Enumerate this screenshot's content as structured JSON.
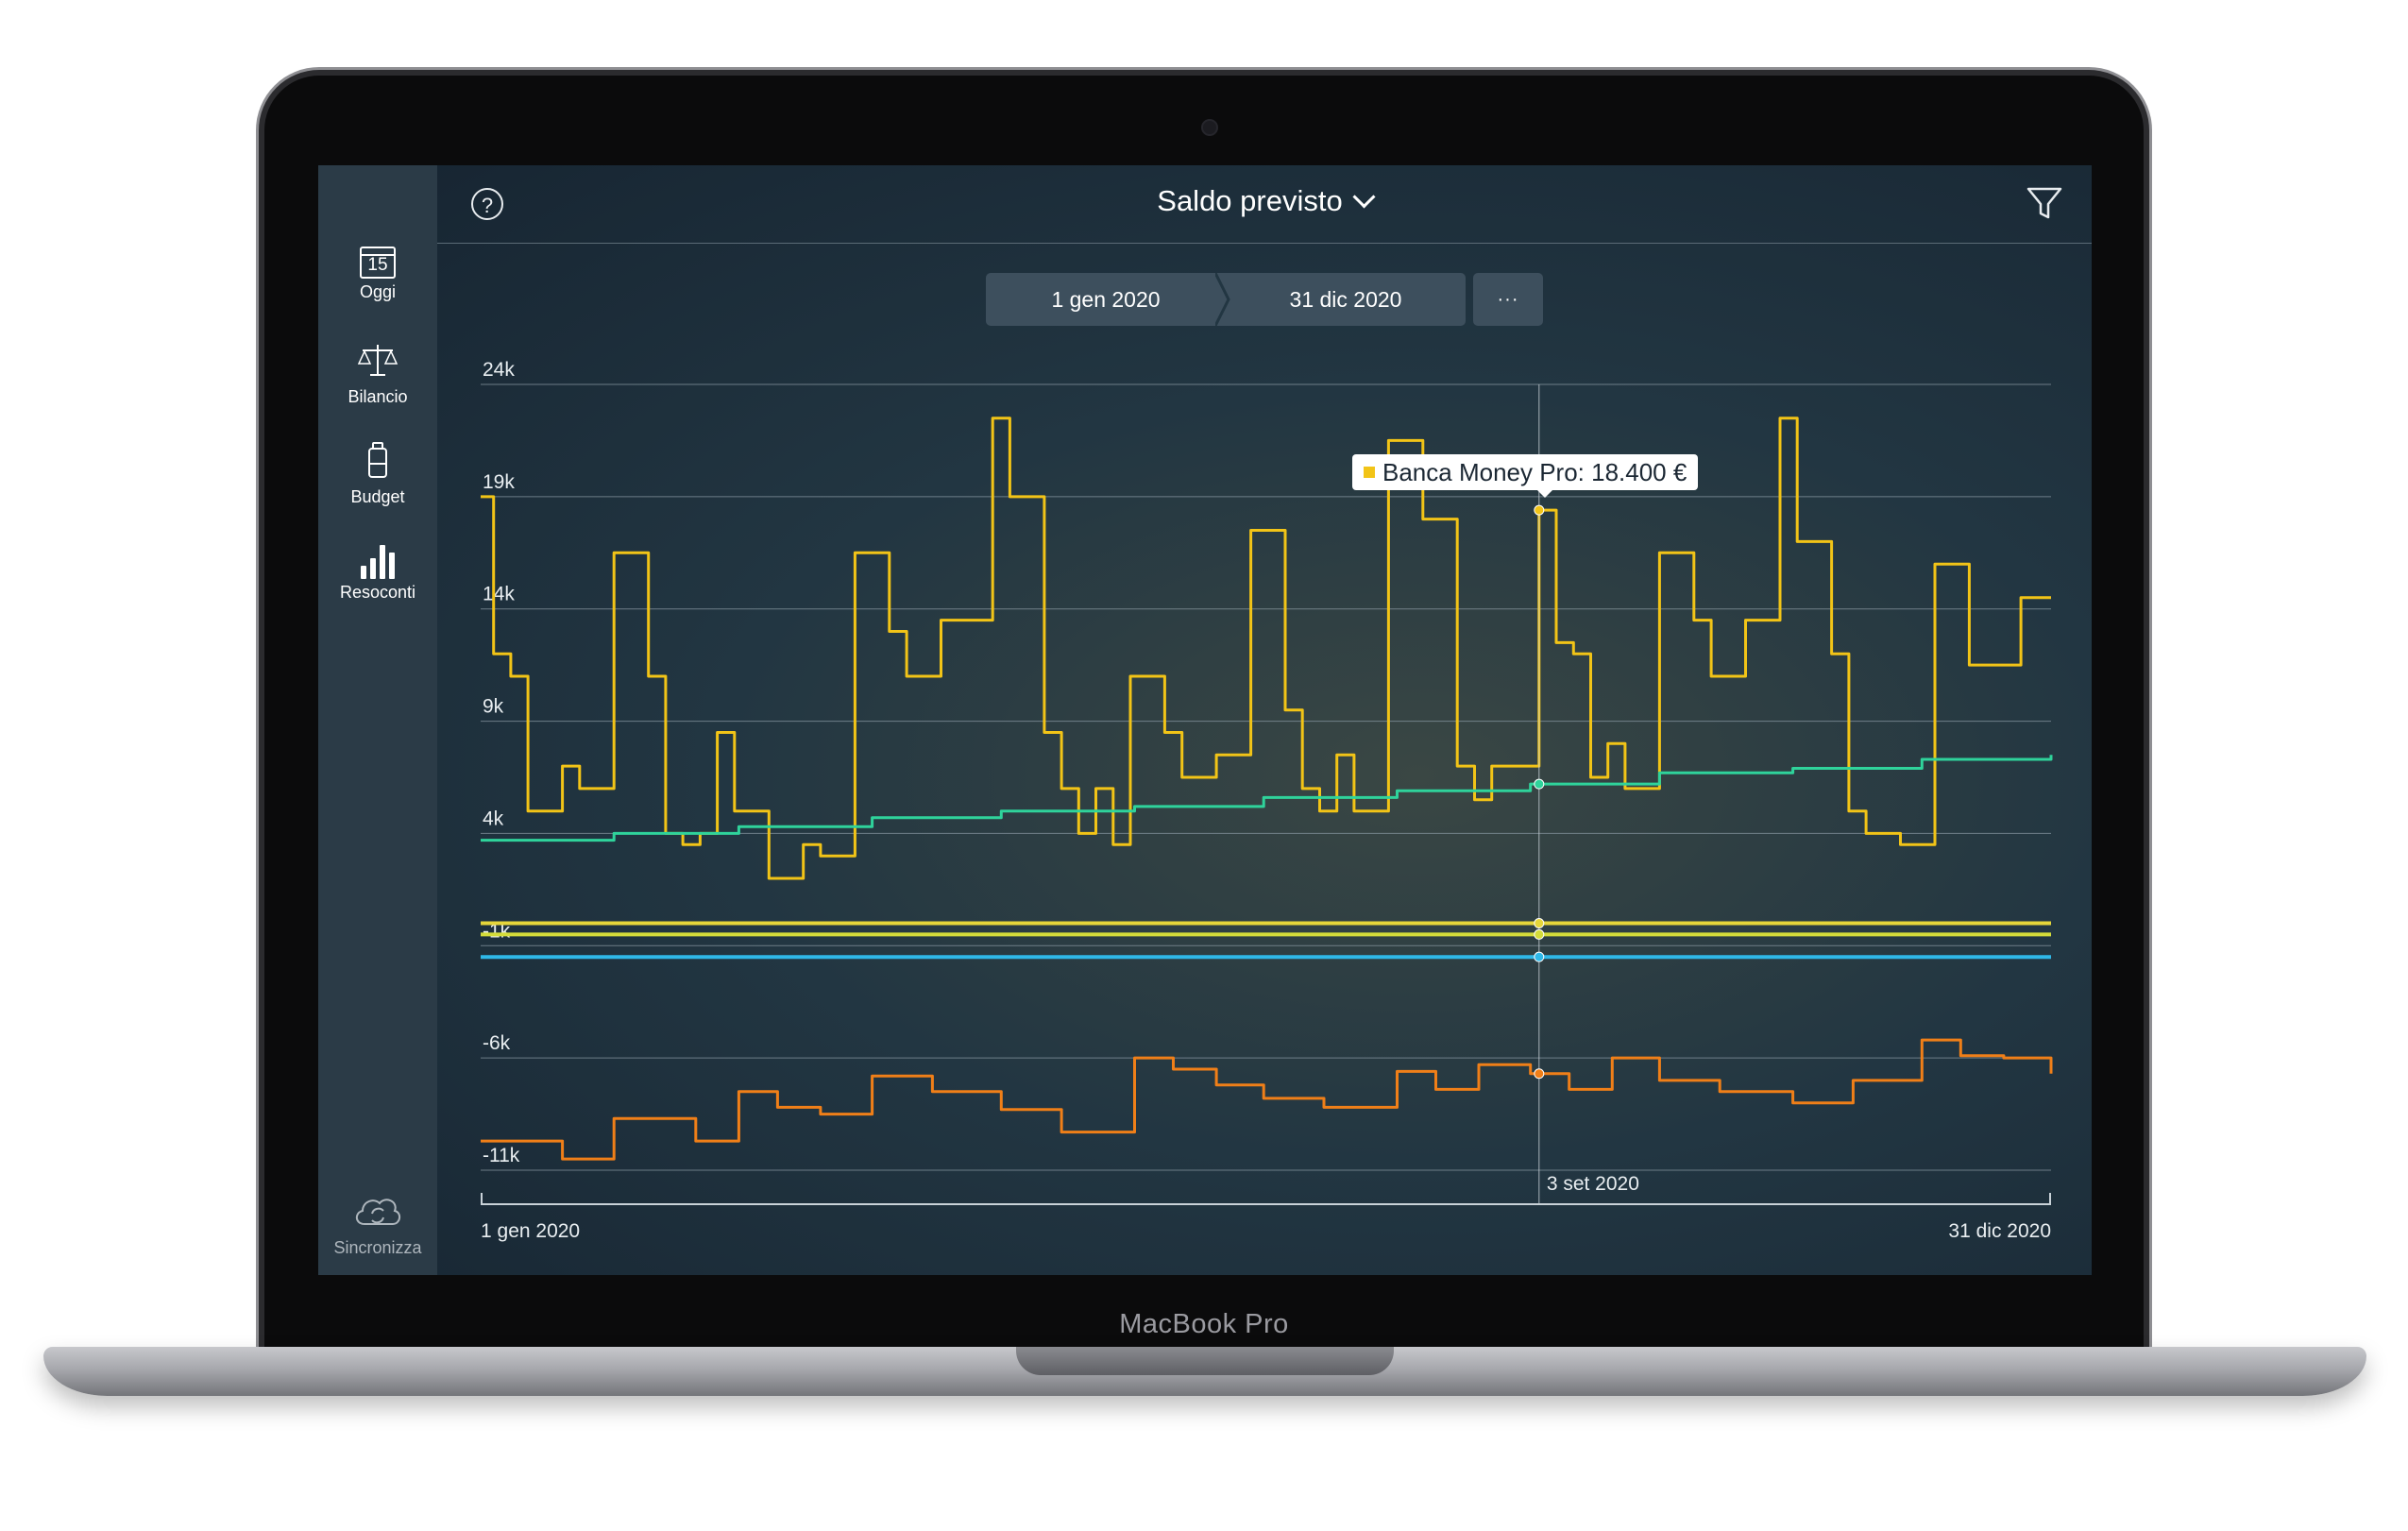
{
  "device": {
    "model_label": "MacBook Pro"
  },
  "sidebar": {
    "items": [
      {
        "label": "Oggi",
        "icon": "calendar-icon",
        "icon_text": "15"
      },
      {
        "label": "Bilancio",
        "icon": "scale-icon"
      },
      {
        "label": "Budget",
        "icon": "budget-icon"
      },
      {
        "label": "Resoconti",
        "icon": "bar-chart-icon"
      }
    ],
    "sync": {
      "label": "Sincronizza",
      "icon": "cloud-sync-icon"
    }
  },
  "header": {
    "title": "Saldo previsto",
    "help_icon": "help-icon",
    "help_text": "?",
    "filter_icon": "filter-icon"
  },
  "date_range": {
    "start": "1 gen 2020",
    "end": "31 dic 2020",
    "more_label": "···"
  },
  "tooltip": {
    "text": "Banca Money Pro: 18.400 €",
    "color": "#f2c417"
  },
  "chart_data": {
    "type": "line",
    "x_start": "1 gen 2020",
    "x_end": "31 dic 2020",
    "x_tick_labels": [
      "1 gen 2020",
      "31 dic 2020"
    ],
    "cursor_label": "3 set 2020",
    "ylim": [
      -11000,
      24000
    ],
    "y_ticks": [
      24000,
      19000,
      14000,
      9000,
      4000,
      -1000,
      -6000,
      -11000
    ],
    "y_tick_labels": [
      "24k",
      "19k",
      "14k",
      "9k",
      "4k",
      "-1k",
      "-6k",
      "-11k"
    ],
    "grid": true,
    "series": [
      {
        "color": "#f2c417",
        "x": [
          "1 gen",
          "4 gen",
          "8 gen",
          "12 gen",
          "16 gen",
          "20 gen",
          "24 gen",
          "28 gen",
          "1 feb",
          "5 feb",
          "9 feb",
          "13 feb",
          "17 feb",
          "21 feb",
          "25 feb",
          "29 feb",
          "4 mar",
          "8 mar",
          "12 mar",
          "16 mar",
          "20 mar",
          "24 mar",
          "28 mar",
          "1 apr",
          "5 apr",
          "9 apr",
          "13 apr",
          "17 apr",
          "21 apr",
          "25 apr",
          "29 apr",
          "3 mag",
          "7 mag",
          "11 mag",
          "15 mag",
          "19 mag",
          "23 mag",
          "27 mag",
          "31 mag",
          "4 giu",
          "8 giu",
          "12 giu",
          "16 giu",
          "20 giu",
          "24 giu",
          "28 giu",
          "2 lug",
          "6 lug",
          "10 lug",
          "14 lug",
          "18 lug",
          "22 lug",
          "26 lug",
          "30 lug",
          "3 ago",
          "7 ago",
          "11 ago",
          "15 ago",
          "19 ago",
          "23 ago",
          "27 ago",
          "31 ago",
          "3 set",
          "7 set",
          "11 set",
          "15 set",
          "19 set",
          "23 set",
          "27 set",
          "1 ott",
          "5 ott",
          "9 ott",
          "13 ott",
          "17 ott",
          "21 ott",
          "25 ott",
          "29 ott",
          "2 nov",
          "6 nov",
          "10 nov",
          "14 nov",
          "18 nov",
          "22 nov",
          "26 nov",
          "30 nov",
          "4 dic",
          "8 dic",
          "12 dic",
          "16 dic",
          "20 dic",
          "24 dic",
          "28 dic",
          "31 dic"
        ],
        "values": [
          19000,
          12000,
          11000,
          5000,
          5000,
          7000,
          6000,
          6000,
          16500,
          16500,
          11000,
          4000,
          3500,
          4000,
          8500,
          5000,
          5000,
          2000,
          2000,
          3500,
          3000,
          3000,
          16500,
          16500,
          13000,
          11000,
          11000,
          13500,
          13500,
          13500,
          22500,
          19000,
          19000,
          8500,
          6000,
          4000,
          6000,
          3500,
          11000,
          11000,
          8500,
          6500,
          6500,
          7500,
          7500,
          17500,
          17500,
          9500,
          6000,
          5000,
          7500,
          5000,
          5000,
          21500,
          21500,
          18000,
          18000,
          7000,
          5500,
          7000,
          7000,
          7000,
          18400,
          12500,
          12000,
          6500,
          8000,
          6000,
          6000,
          16500,
          16500,
          13500,
          11000,
          11000,
          13500,
          13500,
          22500,
          17000,
          17000,
          12000,
          5000,
          4000,
          4000,
          3500,
          3500,
          16000,
          16000,
          11500,
          11500,
          11500,
          14500,
          14500,
          14500
        ],
        "note": "Banca Money Pro"
      },
      {
        "color": "#2fd39b",
        "x": [
          "1 gen",
          "1 feb",
          "1 mar",
          "1 apr",
          "1 mag",
          "1 giu",
          "1 lug",
          "1 ago",
          "1 set",
          "1 ott",
          "1 nov",
          "1 dic",
          "31 dic"
        ],
        "values": [
          3700,
          4000,
          4300,
          4700,
          5000,
          5200,
          5600,
          5900,
          6200,
          6700,
          6900,
          7300,
          7500
        ]
      },
      {
        "color": "#e6d63a",
        "x": [
          "1 gen",
          "31 dic"
        ],
        "values": [
          0,
          0
        ]
      },
      {
        "color": "#d4dc3a",
        "x": [
          "1 gen",
          "31 dic"
        ],
        "values": [
          -500,
          -500
        ]
      },
      {
        "color": "#2fb8e8",
        "x": [
          "1 gen",
          "31 dic"
        ],
        "values": [
          -1500,
          -1500
        ]
      },
      {
        "color": "#f07f18",
        "x": [
          "1 gen",
          "20 gen",
          "1 feb",
          "10 feb",
          "20 feb",
          "1 mar",
          "10 mar",
          "20 mar",
          "1 apr",
          "15 apr",
          "1 mag",
          "15 mag",
          "1 giu",
          "10 giu",
          "20 giu",
          "1 lug",
          "15 lug",
          "1 ago",
          "10 ago",
          "20 ago",
          "1 set",
          "10 set",
          "20 set",
          "1 ott",
          "15 ott",
          "1 nov",
          "15 nov",
          "1 dic",
          "10 dic",
          "20 dic",
          "31 dic"
        ],
        "values": [
          -9700,
          -10500,
          -8700,
          -8700,
          -9700,
          -7500,
          -8200,
          -8500,
          -6800,
          -7500,
          -8300,
          -9300,
          -6000,
          -6500,
          -7200,
          -7800,
          -8200,
          -6600,
          -7400,
          -6300,
          -6700,
          -7400,
          -6000,
          -7000,
          -7500,
          -8000,
          -7000,
          -5200,
          -5900,
          -6000,
          -6700
        ]
      }
    ]
  }
}
